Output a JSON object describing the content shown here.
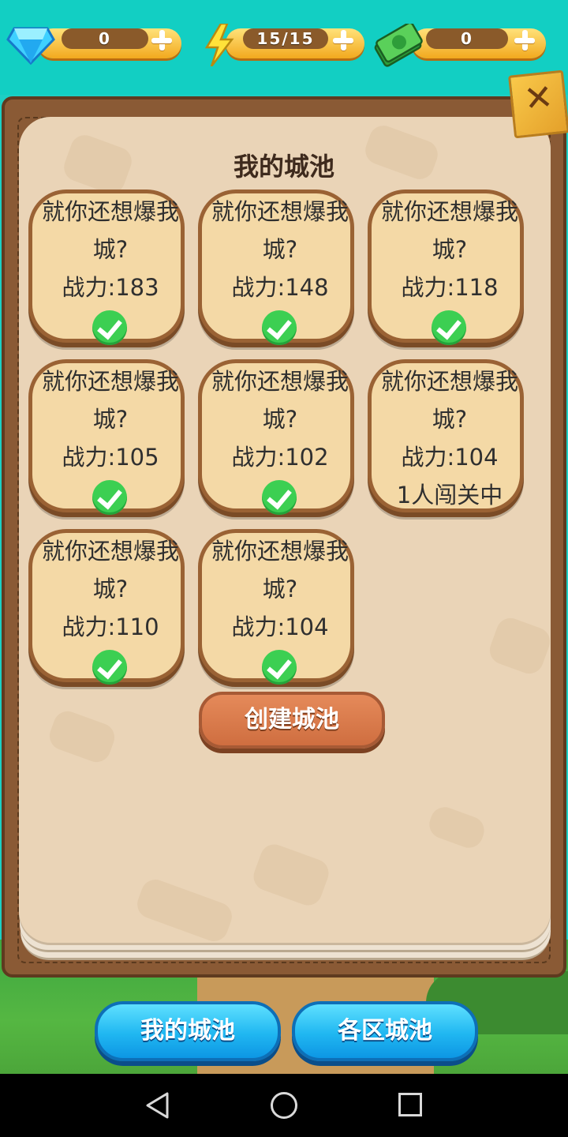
{
  "resources": {
    "gems": "0",
    "energy": "15/15",
    "cash": "0"
  },
  "title": "我的城池",
  "cards": [
    {
      "line1": "就你还想爆我",
      "line2": "城?",
      "power": "战力:183",
      "status": "check"
    },
    {
      "line1": "就你还想爆我",
      "line2": "城?",
      "power": "战力:148",
      "status": "check"
    },
    {
      "line1": "就你还想爆我",
      "line2": "城?",
      "power": "战力:118",
      "status": "check"
    },
    {
      "line1": "就你还想爆我",
      "line2": "城?",
      "power": "战力:105",
      "status": "check"
    },
    {
      "line1": "就你还想爆我",
      "line2": "城?",
      "power": "战力:102",
      "status": "check"
    },
    {
      "line1": "就你还想爆我",
      "line2": "城?",
      "power": "战力:104",
      "status": "1人闯关中"
    },
    {
      "line1": "就你还想爆我",
      "line2": "城?",
      "power": "战力:110",
      "status": "check"
    },
    {
      "line1": "就你还想爆我",
      "line2": "城?",
      "power": "战力:104",
      "status": "check"
    }
  ],
  "create_button": "创建城池",
  "tabs": {
    "mine": "我的城池",
    "regions": "各区城池"
  },
  "icons": [
    "diamond-icon",
    "lightning-icon",
    "cash-icon",
    "plus-icon",
    "close-icon",
    "check-icon",
    "back-icon",
    "home-icon",
    "recent-apps-icon"
  ],
  "colors": {
    "top_bar": "#12cfc3",
    "card_bg": "#f4d9a6",
    "check_green": "#3ccf52",
    "create_button": "#d8774a",
    "tab_button": "#20b7f1"
  }
}
